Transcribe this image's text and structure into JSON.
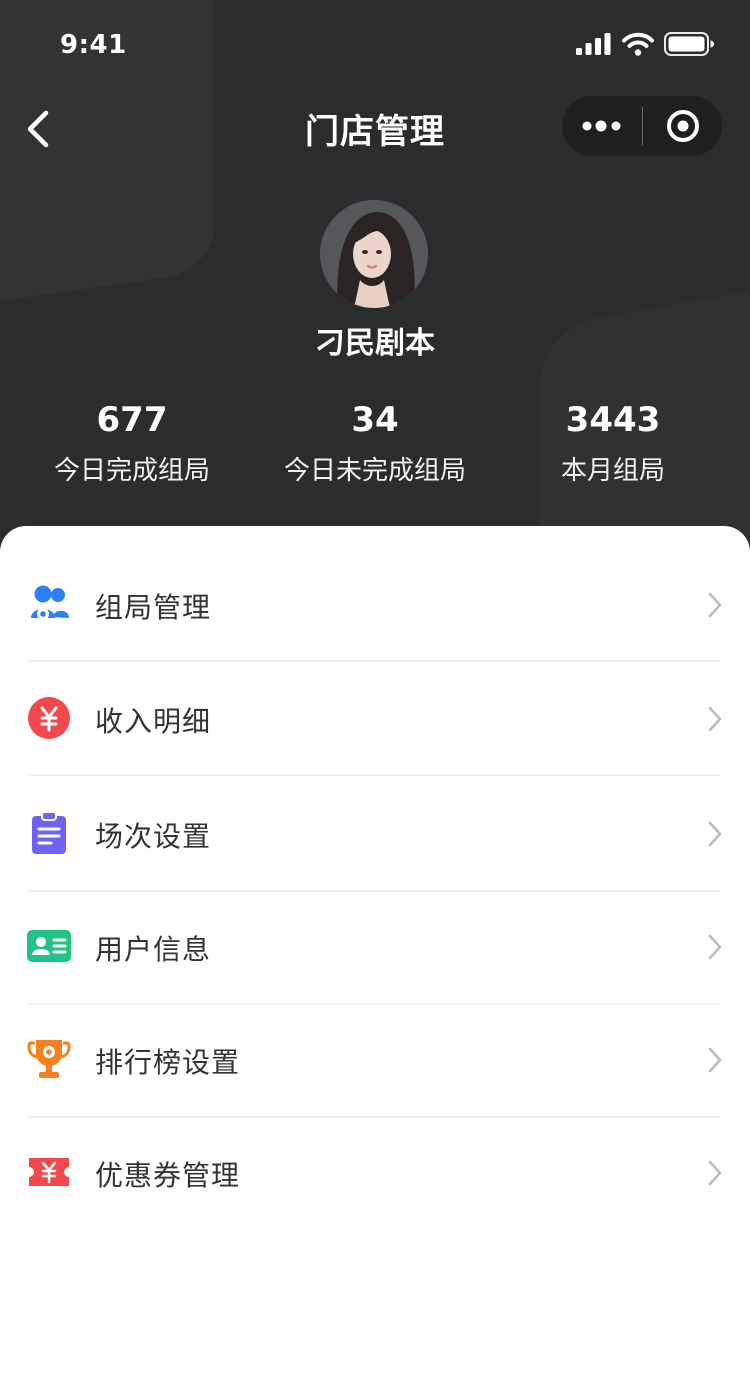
{
  "status_bar": {
    "time": "9:41"
  },
  "nav": {
    "title": "门店管理"
  },
  "profile": {
    "store_name": "刁民剧本"
  },
  "stats": [
    {
      "value": "677",
      "label": "今日完成组局"
    },
    {
      "value": "34",
      "label": "今日未完成组局"
    },
    {
      "value": "3443",
      "label": "本月组局"
    }
  ],
  "menu": [
    {
      "label": "组局管理",
      "icon": "group-users-icon",
      "color": "#2d7ef7"
    },
    {
      "label": "收入明细",
      "icon": "yuan-coin-icon",
      "color": "#f5484d"
    },
    {
      "label": "场次设置",
      "icon": "clipboard-list-icon",
      "color": "#6e63f5"
    },
    {
      "label": "用户信息",
      "icon": "id-card-icon",
      "color": "#22c486"
    },
    {
      "label": "排行榜设置",
      "icon": "trophy-icon",
      "color": "#f5821f"
    },
    {
      "label": "优惠券管理",
      "icon": "coupon-ticket-icon",
      "color": "#f5484d"
    }
  ]
}
